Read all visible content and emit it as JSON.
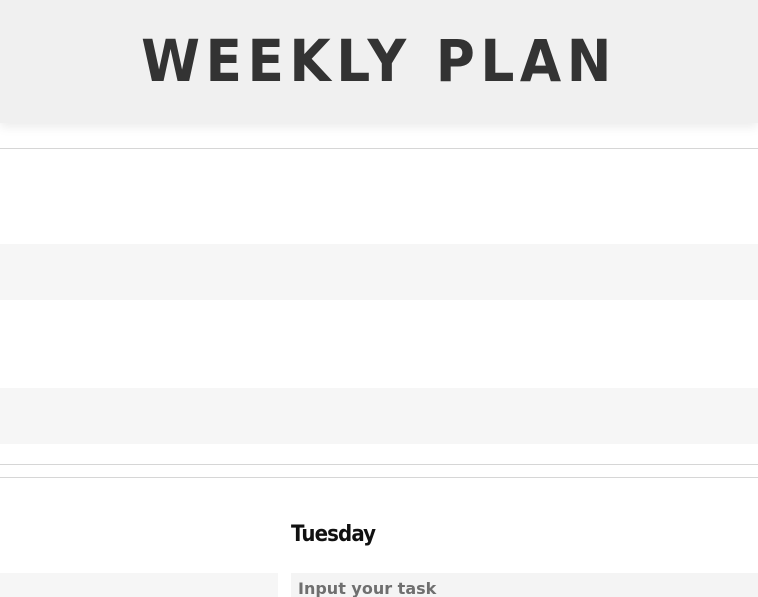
{
  "header": {
    "title": "WEEKLY PLAN"
  },
  "days": [
    {
      "name": "Tuesday",
      "task_input_placeholder": "Input your task"
    }
  ],
  "colors": {
    "header_bg": "#f0f0f0",
    "title_text": "#333333",
    "band_bg": "#f6f6f6",
    "divider": "#d6d6d6"
  }
}
